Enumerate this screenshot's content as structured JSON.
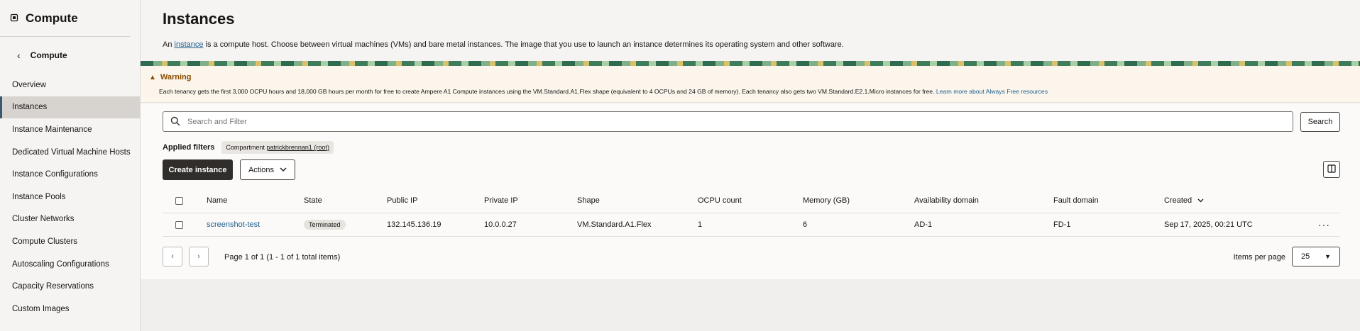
{
  "sidebar": {
    "title": "Compute",
    "back_label": "Compute",
    "items": [
      {
        "label": "Overview",
        "active": false
      },
      {
        "label": "Instances",
        "active": true
      },
      {
        "label": "Instance Maintenance",
        "active": false
      },
      {
        "label": "Dedicated Virtual Machine Hosts",
        "active": false
      },
      {
        "label": "Instance Configurations",
        "active": false
      },
      {
        "label": "Instance Pools",
        "active": false
      },
      {
        "label": "Cluster Networks",
        "active": false
      },
      {
        "label": "Compute Clusters",
        "active": false
      },
      {
        "label": "Autoscaling Configurations",
        "active": false
      },
      {
        "label": "Capacity Reservations",
        "active": false
      },
      {
        "label": "Custom Images",
        "active": false
      }
    ]
  },
  "header": {
    "title": "Instances",
    "desc_prefix": "An ",
    "desc_link": "instance",
    "desc_suffix": " is a compute host. Choose between virtual machines (VMs) and bare metal instances. The image that you use to launch an instance determines its operating system and other software."
  },
  "warning": {
    "title": "Warning",
    "text": "Each tenancy gets the first 3,000 OCPU hours and 18,000 GB hours per month for free to create Ampere A1 Compute instances using the VM.Standard.A1.Flex shape (equivalent to 4 OCPUs and 24 GB of memory). Each tenancy also gets two VM.Standard.E2.1.Micro instances for free.",
    "link": "Learn more about Always Free resources"
  },
  "search": {
    "placeholder": "Search and Filter",
    "button": "Search"
  },
  "filters": {
    "label": "Applied filters",
    "chip_key": "Compartment",
    "chip_value": "patrickbrennan1 (root)"
  },
  "toolbar": {
    "create": "Create instance",
    "actions": "Actions"
  },
  "table": {
    "columns": [
      "Name",
      "State",
      "Public IP",
      "Private IP",
      "Shape",
      "OCPU count",
      "Memory (GB)",
      "Availability domain",
      "Fault domain",
      "Created"
    ],
    "rows": [
      {
        "name": "screenshot-test",
        "state": "Terminated",
        "public_ip": "132.145.136.19",
        "private_ip": "10.0.0.27",
        "shape": "VM.Standard.A1.Flex",
        "ocpu": "1",
        "memory": "6",
        "ad": "AD-1",
        "fd": "FD-1",
        "created": "Sep 17, 2025, 00:21 UTC"
      }
    ]
  },
  "pagination": {
    "text": "Page 1 of 1 (1 - 1 of 1 total items)",
    "items_per_page_label": "Items per page",
    "items_per_page": "25"
  },
  "colors": {
    "primary_button": "#312d2a",
    "link": "#1c5e8c",
    "warning": "#8a4d00"
  }
}
